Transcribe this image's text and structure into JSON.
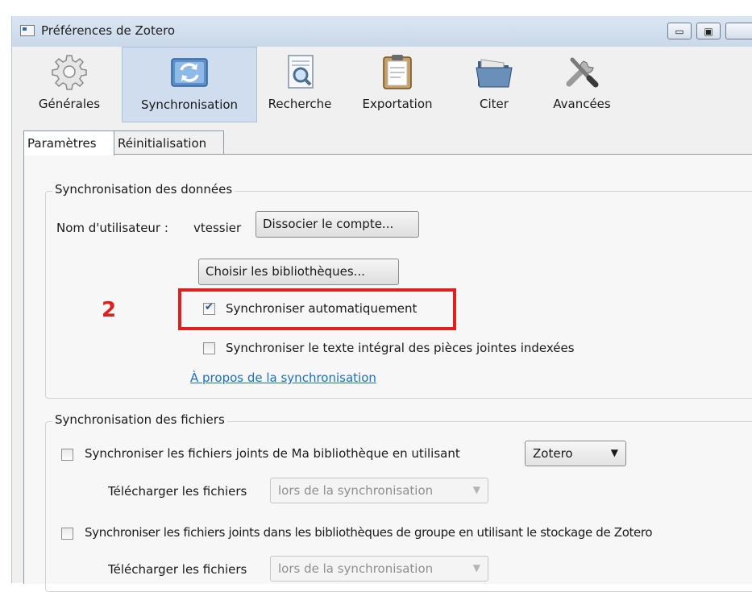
{
  "window": {
    "title": "Préférences de Zotero"
  },
  "toolbar": {
    "items": [
      {
        "label": "Générales",
        "icon": "gear-icon",
        "selected": false
      },
      {
        "label": "Synchronisation",
        "icon": "sync-icon",
        "selected": true
      },
      {
        "label": "Recherche",
        "icon": "search-document-icon",
        "selected": false
      },
      {
        "label": "Exportation",
        "icon": "clipboard-icon",
        "selected": false
      },
      {
        "label": "Citer",
        "icon": "folder-icon",
        "selected": false
      },
      {
        "label": "Avancées",
        "icon": "tools-icon",
        "selected": false
      }
    ]
  },
  "tabs": [
    {
      "label": "Paramètres",
      "active": true
    },
    {
      "label": "Réinitialisation",
      "active": false
    }
  ],
  "data_sync": {
    "legend": "Synchronisation des données",
    "username_label": "Nom d'utilisateur :",
    "username": "vtessier",
    "unlink_button": "Dissocier le compte...",
    "choose_libraries_button": "Choisir les bibliothèques...",
    "auto_sync_label": "Synchroniser automatiquement",
    "auto_sync_checked": true,
    "fulltext_sync_label": "Synchroniser le texte intégral des pièces jointes indexées",
    "fulltext_sync_checked": false,
    "about_link": "À propos de la synchronisation"
  },
  "annotation": {
    "step_number": "2",
    "highlight_color": "#e01f1f"
  },
  "file_sync": {
    "legend": "Synchronisation des fichiers",
    "my_library_label": "Synchroniser les fichiers joints de Ma bibliothèque en utilisant",
    "my_library_checked": false,
    "my_library_service": "Zotero",
    "download_label_1": "Télécharger les fichiers",
    "download_value_1": "lors de la synchronisation",
    "group_label": "Synchroniser les fichiers joints dans les bibliothèques de groupe en utilisant le stockage de Zotero",
    "group_checked": false,
    "download_label_2": "Télécharger les fichiers",
    "download_value_2": "lors de la synchronisation"
  },
  "colors": {
    "link": "#1a6fc9",
    "selected_tab": "#cfddef"
  }
}
